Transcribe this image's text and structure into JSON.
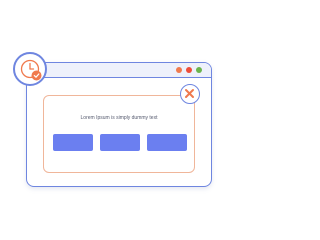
{
  "window": {
    "traffic_lights": {
      "colors": [
        "#f07a4e",
        "#ee4d3a",
        "#6bb44c"
      ]
    }
  },
  "dialog": {
    "message": "Lorem Ipsum is simply dummy text",
    "buttons": [
      {
        "icon": "none",
        "color": "#6b7ff0"
      },
      {
        "icon": "none",
        "color": "#6b7ff0"
      },
      {
        "icon": "none",
        "color": "#6b7ff0"
      }
    ]
  },
  "icons": {
    "close": "close-icon",
    "clock": "clock-icon",
    "check": "check-badge-icon"
  },
  "colors": {
    "accent": "#6f86e0",
    "button": "#6b7ff0",
    "orange": "#f07a4e",
    "dialog_border": "#f0b69a"
  }
}
